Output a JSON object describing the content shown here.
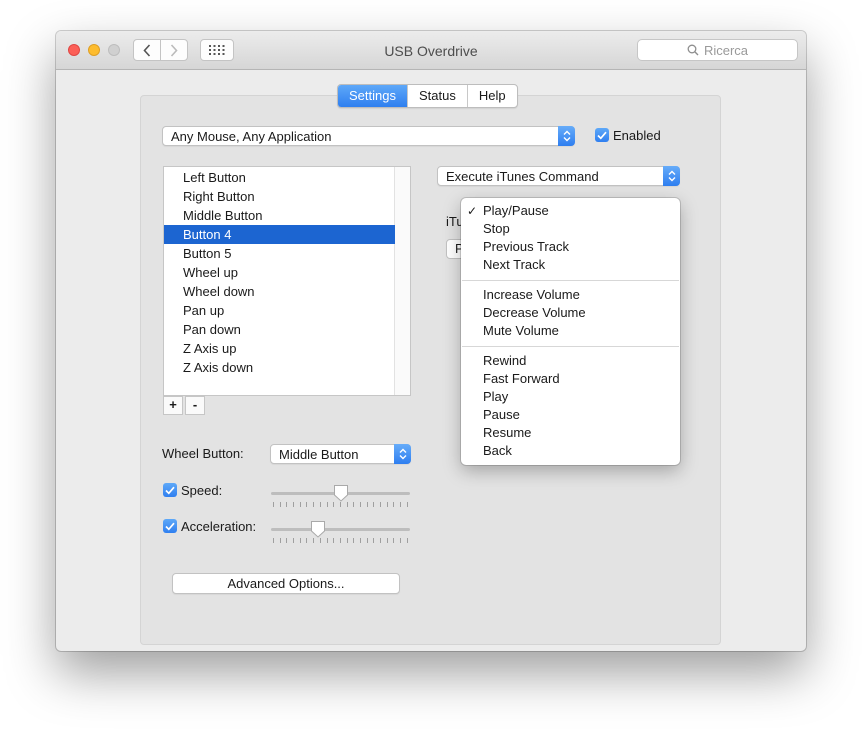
{
  "window": {
    "title": "USB Overdrive",
    "search_placeholder": "Ricerca"
  },
  "tabs": [
    {
      "label": "Settings",
      "active": true
    },
    {
      "label": "Status",
      "active": false
    },
    {
      "label": "Help",
      "active": false
    }
  ],
  "device_select": {
    "value": "Any Mouse, Any Application"
  },
  "enabled": {
    "label": "Enabled",
    "checked": true
  },
  "buttons_list": {
    "items": [
      "Left Button",
      "Right Button",
      "Middle Button",
      "Button 4",
      "Button 5",
      "Wheel up",
      "Wheel down",
      "Pan up",
      "Pan down",
      "Z Axis up",
      "Z Axis down"
    ],
    "selected": "Button 4",
    "add_label": "+",
    "remove_label": "-"
  },
  "action_select": {
    "value": "Execute iTunes Command"
  },
  "itunes_label_partial": "iTu",
  "hidden_field_partial": "P",
  "wheel_button": {
    "label": "Wheel Button:",
    "value": "Middle Button"
  },
  "speed": {
    "label": "Speed:",
    "checked": true,
    "level": 0.5
  },
  "acceleration": {
    "label": "Acceleration:",
    "checked": true,
    "level": 0.32
  },
  "advanced_button": "Advanced Options...",
  "itunes_menu": {
    "groups": [
      [
        "Play/Pause",
        "Stop",
        "Previous Track",
        "Next Track"
      ],
      [
        "Increase Volume",
        "Decrease Volume",
        "Mute Volume"
      ],
      [
        "Rewind",
        "Fast Forward",
        "Play",
        "Pause",
        "Resume",
        "Back"
      ]
    ],
    "checked": "Play/Pause",
    "check_glyph": "✓"
  },
  "colors": {
    "accent": "#2f7ff0",
    "selection": "#1c65d1",
    "window_bg": "#ececec"
  }
}
